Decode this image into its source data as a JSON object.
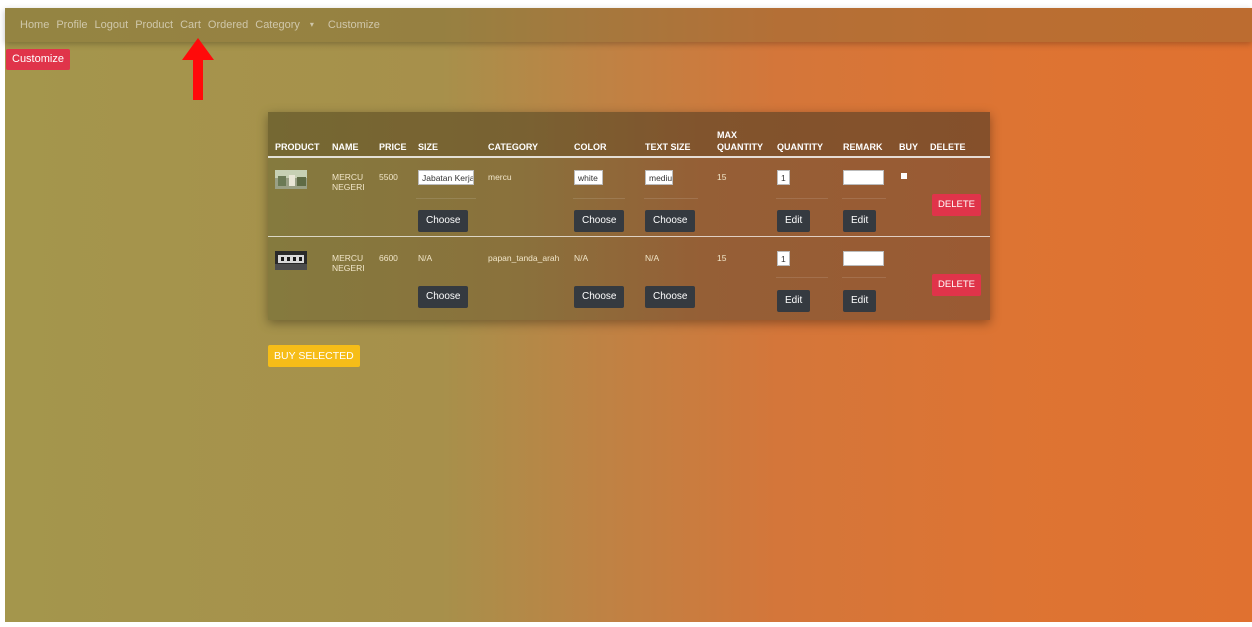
{
  "nav": {
    "items": [
      "Home",
      "Profile",
      "Logout",
      "Product",
      "Cart",
      "Ordered",
      "Category",
      "Customize"
    ],
    "caret": "▾"
  },
  "customize_button": "Customize",
  "table": {
    "headers": {
      "product": "PRODUCT",
      "name": "NAME",
      "price": "PRICE",
      "size": "SIZE",
      "category": "CATEGORY",
      "color": "COLOR",
      "text_size": "TEXT SIZE",
      "max_quantity_1": "MAX",
      "max_quantity_2": "QUANTITY",
      "quantity": "QUANTITY",
      "remark": "REMARK",
      "buy": "BUY",
      "delete": "DELETE"
    },
    "rows": [
      {
        "name_1": "MERCU",
        "name_2": "NEGERI",
        "price": "5500",
        "size_value": "Jabatan Kerja",
        "category": "mercu",
        "color_value": "white",
        "text_size_value": "mediu",
        "max_quantity": "15",
        "quantity": "1",
        "remark": ""
      },
      {
        "name_1": "MERCU",
        "name_2": "NEGERI",
        "price": "6600",
        "size": "N/A",
        "category": "papan_tanda_arah",
        "color": "N/A",
        "text_size": "N/A",
        "max_quantity": "15",
        "quantity": "1",
        "remark": ""
      }
    ],
    "choose_label": "Choose",
    "edit_label": "Edit",
    "delete_label": "DELETE"
  },
  "buy_selected_button": "BUY SELECTED",
  "colors": {
    "accent_red": "#e0344a",
    "dark_button": "#353a40",
    "warning": "#f6bd18"
  }
}
